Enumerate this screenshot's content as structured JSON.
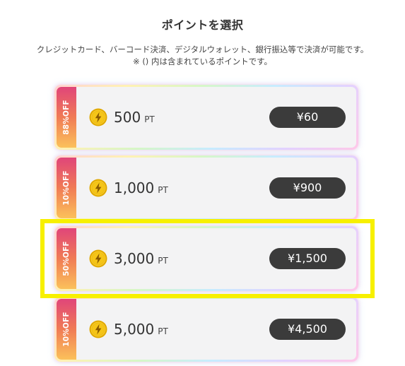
{
  "header": {
    "title": "ポイントを選択",
    "subtitle_line1": "クレジットカード、バーコード決済、デジタルウォレット、銀行振込等で決済が可能です。",
    "subtitle_line2": "※ () 内は含まれているポイントです。"
  },
  "icons": {
    "coin": "lightning-coin-icon"
  },
  "colors": {
    "highlight": "#f7f000",
    "price_button": "#3b3b3b",
    "badge_top": "#e0457a",
    "badge_bottom": "#fbc15b",
    "coin": "#f5c518"
  },
  "options": [
    {
      "discount": "88%OFF",
      "points": "500",
      "unit": "PT",
      "price": "¥60",
      "selected": false
    },
    {
      "discount": "10%OFF",
      "points": "1,000",
      "unit": "PT",
      "price": "¥900",
      "selected": false
    },
    {
      "discount": "50%OFF",
      "points": "3,000",
      "unit": "PT",
      "price": "¥1,500",
      "selected": true
    },
    {
      "discount": "10%OFF",
      "points": "5,000",
      "unit": "PT",
      "price": "¥4,500",
      "selected": false
    }
  ]
}
